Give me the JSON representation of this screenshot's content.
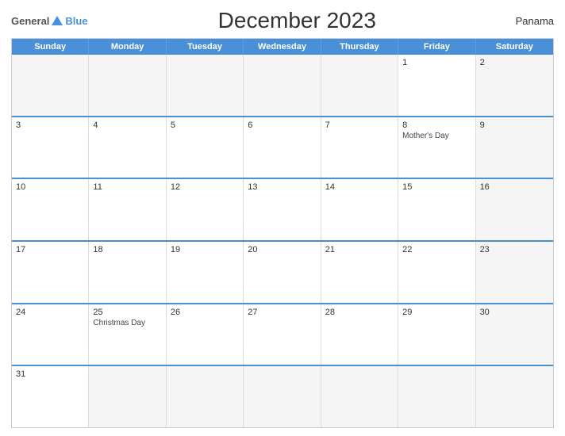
{
  "header": {
    "logo": {
      "general": "General",
      "blue": "Blue"
    },
    "title": "December 2023",
    "country": "Panama"
  },
  "dayHeaders": [
    "Sunday",
    "Monday",
    "Tuesday",
    "Wednesday",
    "Thursday",
    "Friday",
    "Saturday"
  ],
  "weeks": [
    [
      {
        "day": "",
        "empty": true
      },
      {
        "day": "",
        "empty": true
      },
      {
        "day": "",
        "empty": true
      },
      {
        "day": "",
        "empty": true
      },
      {
        "day": "",
        "empty": true
      },
      {
        "day": "1",
        "empty": false
      },
      {
        "day": "2",
        "empty": false
      }
    ],
    [
      {
        "day": "3",
        "empty": false
      },
      {
        "day": "4",
        "empty": false
      },
      {
        "day": "5",
        "empty": false
      },
      {
        "day": "6",
        "empty": false
      },
      {
        "day": "7",
        "empty": false
      },
      {
        "day": "8",
        "empty": false,
        "event": "Mother's Day"
      },
      {
        "day": "9",
        "empty": false
      }
    ],
    [
      {
        "day": "10",
        "empty": false
      },
      {
        "day": "11",
        "empty": false
      },
      {
        "day": "12",
        "empty": false
      },
      {
        "day": "13",
        "empty": false
      },
      {
        "day": "14",
        "empty": false
      },
      {
        "day": "15",
        "empty": false
      },
      {
        "day": "16",
        "empty": false
      }
    ],
    [
      {
        "day": "17",
        "empty": false
      },
      {
        "day": "18",
        "empty": false
      },
      {
        "day": "19",
        "empty": false
      },
      {
        "day": "20",
        "empty": false
      },
      {
        "day": "21",
        "empty": false
      },
      {
        "day": "22",
        "empty": false
      },
      {
        "day": "23",
        "empty": false
      }
    ],
    [
      {
        "day": "24",
        "empty": false
      },
      {
        "day": "25",
        "empty": false,
        "event": "Christmas Day"
      },
      {
        "day": "26",
        "empty": false
      },
      {
        "day": "27",
        "empty": false
      },
      {
        "day": "28",
        "empty": false
      },
      {
        "day": "29",
        "empty": false
      },
      {
        "day": "30",
        "empty": false
      }
    ],
    [
      {
        "day": "31",
        "empty": false
      },
      {
        "day": "",
        "empty": true
      },
      {
        "day": "",
        "empty": true
      },
      {
        "day": "",
        "empty": true
      },
      {
        "day": "",
        "empty": true
      },
      {
        "day": "",
        "empty": true
      },
      {
        "day": "",
        "empty": true
      }
    ]
  ],
  "colors": {
    "accent": "#4a90d9",
    "headerText": "#fff",
    "shaded": "#f5f5f5"
  }
}
